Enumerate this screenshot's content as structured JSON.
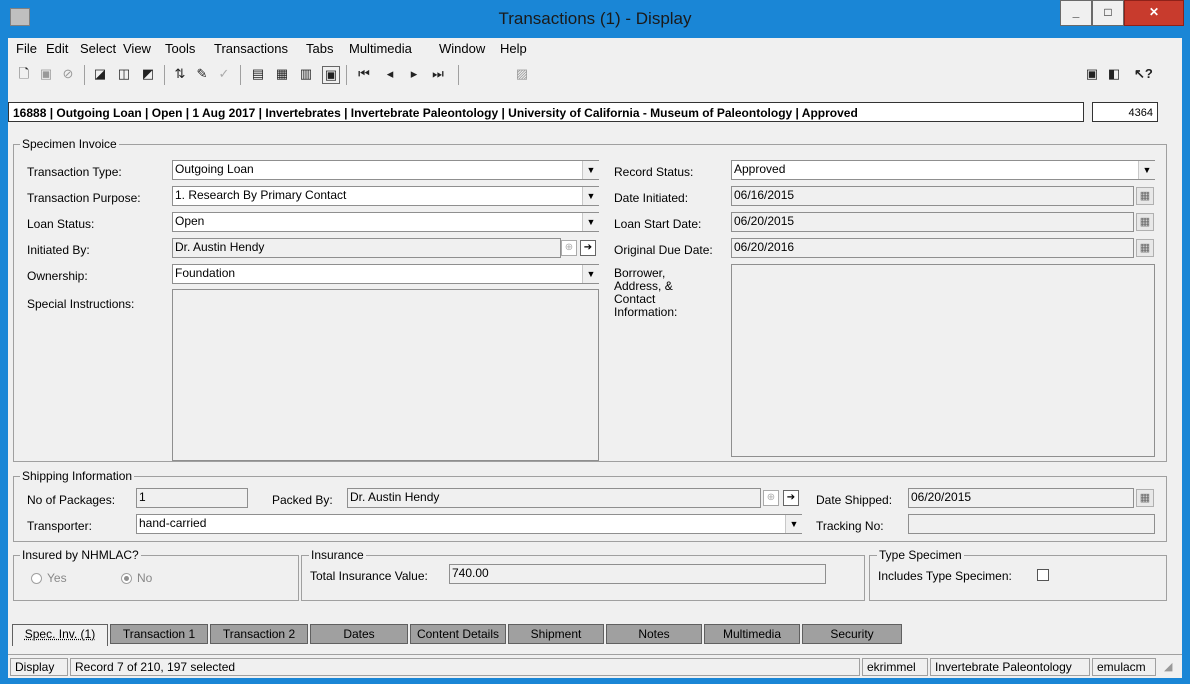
{
  "window": {
    "title": "Transactions (1) - Display"
  },
  "menu": [
    "File",
    "Edit",
    "Select",
    "View",
    "Tools",
    "Transactions",
    "Tabs",
    "Multimedia",
    "Window",
    "Help"
  ],
  "banner": {
    "text": "16888 | Outgoing Loan | Open | 1 Aug 2017 | Invertebrates | Invertebrate Paleontology | University of California - Museum of Paleontology | Approved",
    "record_number": "4364"
  },
  "specimen_invoice": {
    "title": "Specimen Invoice",
    "transaction_type": {
      "label": "Transaction Type:",
      "value": "Outgoing Loan"
    },
    "transaction_purpose": {
      "label": "Transaction Purpose:",
      "value": "1. Research By Primary Contact"
    },
    "loan_status": {
      "label": "Loan Status:",
      "value": "Open"
    },
    "initiated_by": {
      "label": "Initiated By:",
      "value": "Dr. Austin Hendy"
    },
    "ownership": {
      "label": "Ownership:",
      "value": "Foundation"
    },
    "special_instructions": {
      "label": "Special Instructions:",
      "value": ""
    },
    "record_status": {
      "label": "Record Status:",
      "value": "Approved"
    },
    "date_initiated": {
      "label": "Date Initiated:",
      "value": "06/16/2015"
    },
    "loan_start_date": {
      "label": "Loan Start Date:",
      "value": "06/20/2015"
    },
    "original_due_date": {
      "label": "Original Due Date:",
      "value": "06/20/2016"
    },
    "borrower": {
      "label_lines": [
        "Borrower,",
        "Address, &",
        "Contact",
        "Information:"
      ],
      "value": ""
    }
  },
  "shipping": {
    "title": "Shipping Information",
    "packages": {
      "label": "No of Packages:",
      "value": "1"
    },
    "packed_by": {
      "label": "Packed By:",
      "value": "Dr. Austin Hendy"
    },
    "date_shipped": {
      "label": "Date Shipped:",
      "value": "06/20/2015"
    },
    "transporter": {
      "label": "Transporter:",
      "value": "hand-carried"
    },
    "tracking": {
      "label": "Tracking No:",
      "value": ""
    }
  },
  "insured": {
    "title": "Insured by NHMLAC?",
    "yes": "Yes",
    "no": "No",
    "selected": "No"
  },
  "insurance": {
    "title": "Insurance",
    "label": "Total Insurance Value:",
    "value": "740.00"
  },
  "type_specimen": {
    "title": "Type Specimen",
    "label": "Includes Type Specimen:",
    "checked": false
  },
  "tabs": [
    "Spec. Inv. (1)",
    "Transaction 1",
    "Transaction 2",
    "Dates",
    "Content Details",
    "Shipment",
    "Notes",
    "Multimedia",
    "Security"
  ],
  "status": {
    "mode": "Display",
    "record": "Record 7 of 210, 197 selected",
    "user": "ekrimmel",
    "dept": "Invertebrate Paleontology",
    "server": "emulacm"
  }
}
